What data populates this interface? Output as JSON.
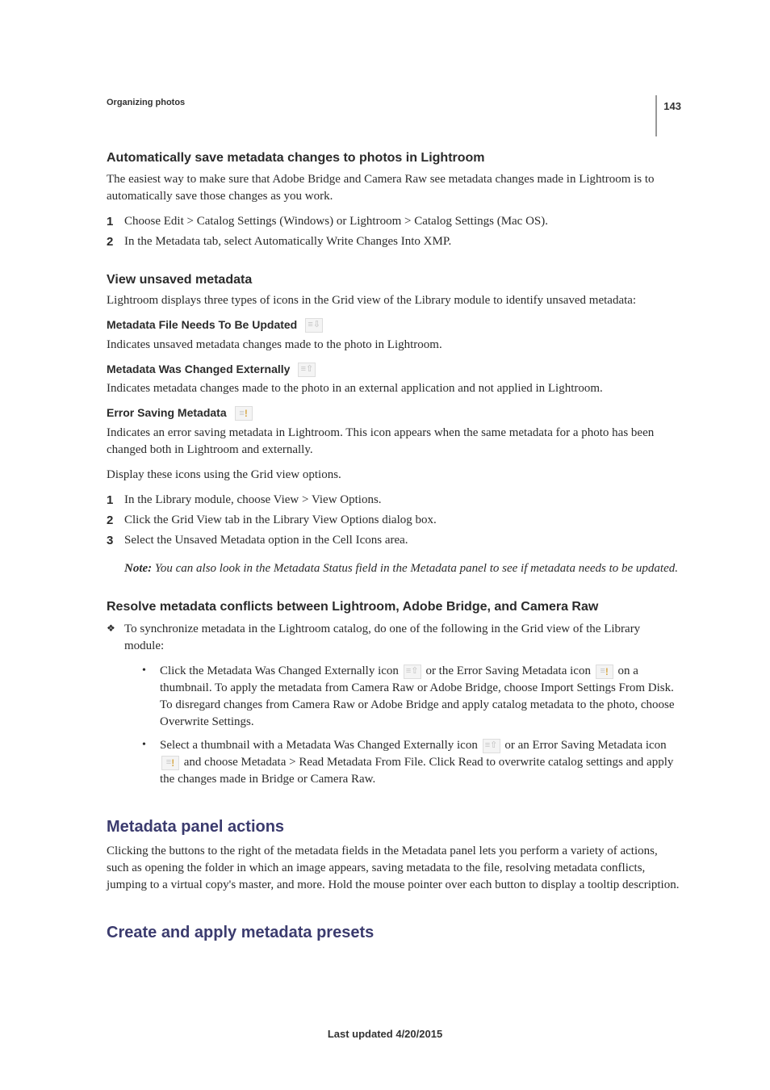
{
  "page_number": "143",
  "running_header": "Organizing photos",
  "sections": {
    "auto_save": {
      "title": "Automatically save metadata changes to photos in Lightroom",
      "intro": "The easiest way to make sure that Adobe Bridge and Camera Raw see metadata changes made in Lightroom is to automatically save those changes as you work.",
      "steps": [
        "Choose Edit > Catalog Settings (Windows) or Lightroom > Catalog Settings (Mac OS).",
        "In the Metadata tab, select Automatically Write Changes Into XMP."
      ]
    },
    "view_unsaved": {
      "title": "View unsaved metadata",
      "intro": "Lightroom displays three types of icons in the Grid view of the Library module to identify unsaved metadata:",
      "terms": [
        {
          "label": "Metadata File Needs To Be Updated",
          "icon": "metadata-needs-update-icon",
          "desc": "Indicates unsaved metadata changes made to the photo in Lightroom."
        },
        {
          "label": "Metadata Was Changed Externally",
          "icon": "metadata-changed-externally-icon",
          "desc": "Indicates metadata changes made to the photo in an external application and not applied in Lightroom."
        },
        {
          "label": "Error Saving Metadata",
          "icon": "error-saving-metadata-icon",
          "desc": "Indicates an error saving metadata in Lightroom. This icon appears when the same metadata for a photo has been changed both in Lightroom and externally."
        }
      ],
      "display_line": "Display these icons using the Grid view options.",
      "steps": [
        "In the Library module, choose View > View Options.",
        "Click the Grid View tab in the Library View Options dialog box.",
        "Select the Unsaved Metadata option in the Cell Icons area."
      ],
      "note_label": "Note:",
      "note_body": " You can also look in the Metadata Status field in the Metadata panel to see if metadata needs to be updated."
    },
    "resolve": {
      "title": "Resolve metadata conflicts between Lightroom, Adobe Bridge, and Camera Raw",
      "bullet_intro": "To synchronize metadata in the Lightroom catalog, do one of the following in the Grid view of the Library module:",
      "sub1": {
        "pre": "Click the Metadata Was Changed Externally icon ",
        "mid": " or the Error Saving Metadata icon ",
        "post": " on a thumbnail. To apply the metadata from Camera Raw or Adobe Bridge, choose Import Settings From Disk. To disregard changes from Camera Raw or Adobe Bridge and apply catalog metadata to the photo, choose Overwrite Settings."
      },
      "sub2": {
        "pre": "Select a thumbnail with a Metadata Was Changed Externally icon ",
        "mid": " or an Error Saving Metadata icon ",
        "post": " and choose Metadata > Read Metadata From File. Click Read to overwrite catalog settings and apply the changes made in Bridge or Camera Raw."
      }
    },
    "panel_actions": {
      "title": "Metadata panel actions",
      "body": "Clicking the buttons to the right of the metadata fields in the Metadata panel lets you perform a variety of actions, such as opening the folder in which an image appears, saving metadata to the file, resolving metadata conflicts, jumping to a virtual copy's master, and more. Hold the mouse pointer over each button to display a tooltip description."
    },
    "create_presets": {
      "title": "Create and apply metadata presets"
    }
  },
  "footer": "Last updated 4/20/2015"
}
